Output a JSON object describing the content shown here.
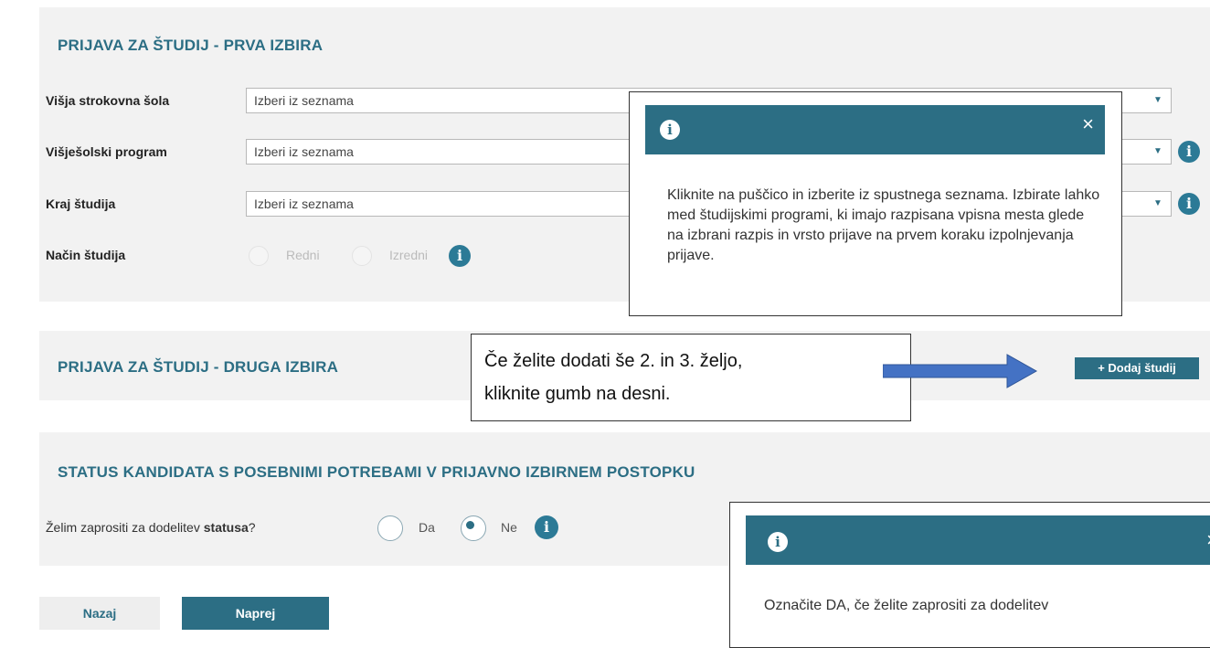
{
  "first_choice": {
    "title": "PRIJAVA ZA ŠTUDIJ - PRVA IZBIRA",
    "fields": [
      {
        "label": "Višja strokovna šola",
        "value": "Izberi iz seznama"
      },
      {
        "label": "Višješolski program",
        "value": "Izberi iz seznama"
      },
      {
        "label": "Kraj študija",
        "value": "Izberi iz seznama"
      }
    ],
    "study_mode": {
      "label": "Način študija",
      "options": [
        "Redni",
        "Izredni"
      ]
    }
  },
  "tooltip_program": {
    "text": "Kliknite na puščico in izberite iz spustnega seznama. Izbirate lahko med študijskimi programi, ki imajo razpisana vpisna mesta glede na izbrani razpis in vrsto prijave na prvem koraku izpolnjevanja prijave.",
    "close": "×"
  },
  "second_choice": {
    "title": "PRIJAVA ZA ŠTUDIJ - DRUGA IZBIRA",
    "add_button": "+ Dodaj študij"
  },
  "callout": {
    "line1": "Če želite dodati še 2. in 3. željo,",
    "line2": "kliknite gumb na desni."
  },
  "status": {
    "title": "STATUS KANDIDATA S POSEBNIMI POTREBAMI V PRIJAVNO IZBIRNEM POSTOPKU",
    "question_prefix": "Želim zaprositi za dodelitev ",
    "question_bold": "statusa",
    "question_suffix": "?",
    "options": [
      "Da",
      "Ne"
    ],
    "selected": "Ne"
  },
  "tooltip_status": {
    "text": "Označite DA, če želite zaprositi za dodelitev",
    "close": "×"
  },
  "nav": {
    "back": "Nazaj",
    "next": "Naprej"
  },
  "colors": {
    "accent": "#2c6e84",
    "panel": "#f2f2f2",
    "arrow": "#4472c4"
  }
}
